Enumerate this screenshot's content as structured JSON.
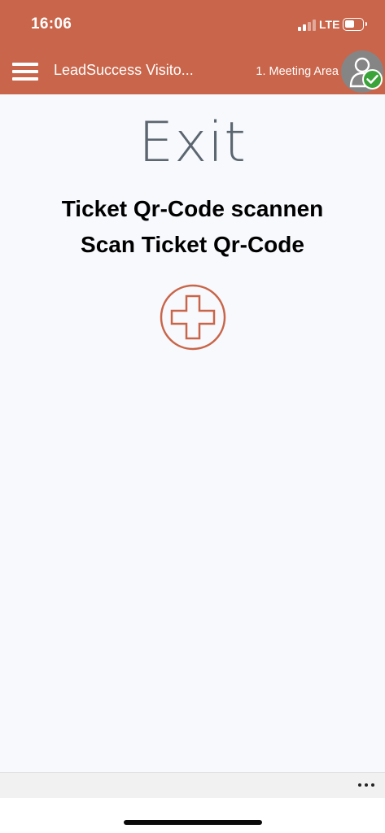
{
  "status_bar": {
    "time": "16:06",
    "network": "LTE",
    "signal_bars_active": 2,
    "signal_bars_total": 4
  },
  "header": {
    "title": "LeadSuccess Visito...",
    "location": "1. Meeting Area",
    "menu_icon": "hamburger-menu-icon",
    "avatar_icon": "user-avatar-icon",
    "badge_icon": "checkmark-icon"
  },
  "main": {
    "heading": "Exit",
    "instruction_de": "Ticket Qr-Code scannen",
    "instruction_en": "Scan Ticket Qr-Code",
    "add_icon": "plus-circle-icon"
  },
  "bottom_bar": {
    "more_icon": "more-horizontal-icon"
  },
  "colors": {
    "accent": "#c9654a",
    "heading": "#5c6670",
    "background": "#f7f9fc",
    "success": "#3aa33a",
    "avatar_bg": "#858585"
  }
}
